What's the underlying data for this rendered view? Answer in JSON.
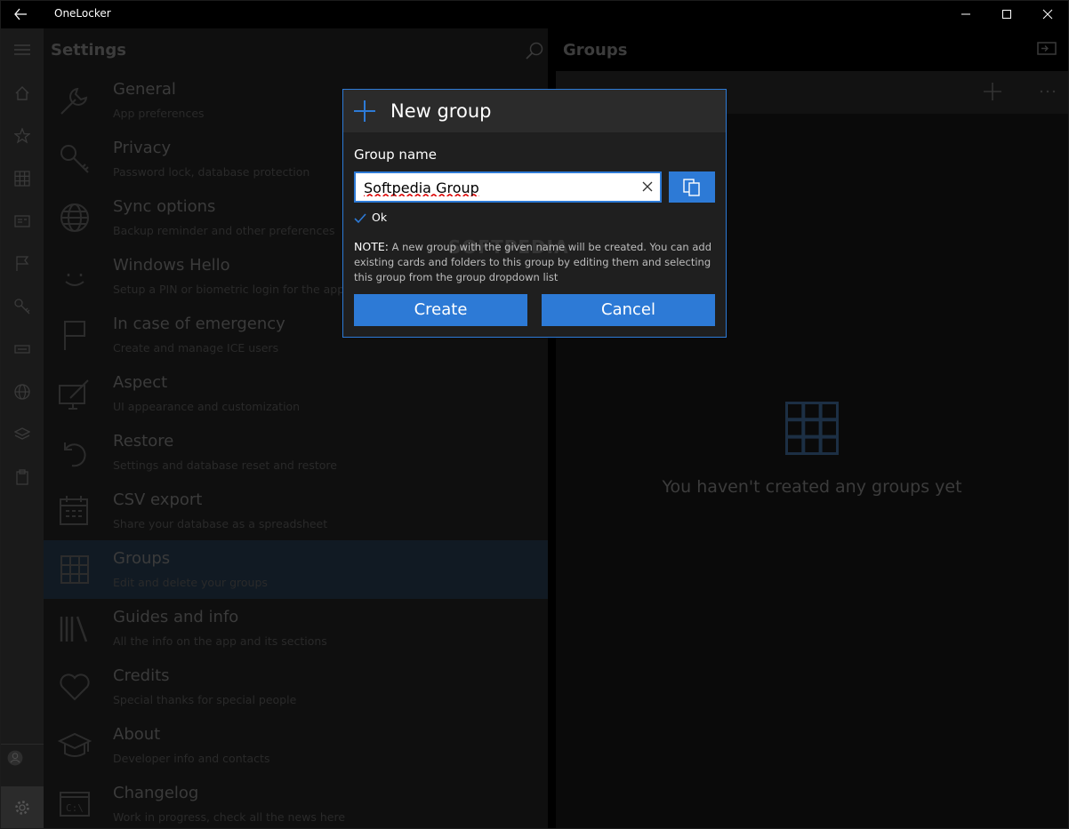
{
  "titlebar": {
    "app_title": "OneLocker"
  },
  "settings": {
    "heading": "Settings",
    "items": [
      {
        "title": "General",
        "subtitle": "App preferences",
        "icon": "wrench-icon"
      },
      {
        "title": "Privacy",
        "subtitle": "Password lock, database protection",
        "icon": "key-icon"
      },
      {
        "title": "Sync options",
        "subtitle": "Backup reminder and other preferences",
        "icon": "globe-icon"
      },
      {
        "title": "Windows Hello",
        "subtitle": "Setup a PIN or biometric login for the app",
        "icon": "smile-icon"
      },
      {
        "title": "In case of emergency",
        "subtitle": "Create and manage ICE users",
        "icon": "flag-icon"
      },
      {
        "title": "Aspect",
        "subtitle": "UI appearance and customization",
        "icon": "paint-icon"
      },
      {
        "title": "Restore",
        "subtitle": "Settings and database reset and restore",
        "icon": "undo-icon"
      },
      {
        "title": "CSV export",
        "subtitle": "Share your database as a spreadsheet",
        "icon": "calendar-icon"
      },
      {
        "title": "Groups",
        "subtitle": "Edit and delete your groups",
        "icon": "grid-icon",
        "selected": true
      },
      {
        "title": "Guides and info",
        "subtitle": "All the info on the app and its sections",
        "icon": "books-icon"
      },
      {
        "title": "Credits",
        "subtitle": "Special thanks for special people",
        "icon": "heart-icon"
      },
      {
        "title": "About",
        "subtitle": "Developer info and contacts",
        "icon": "graduation-cap-icon"
      },
      {
        "title": "Changelog",
        "subtitle": "Work in progress, check all the news here",
        "icon": "terminal-icon"
      }
    ]
  },
  "groups": {
    "heading": "Groups",
    "empty_text": "You haven't created any groups yet"
  },
  "dialog": {
    "title": "New group",
    "field_label": "Group name",
    "field_value": "Softpedia Group",
    "validation": "Ok",
    "note_label": "NOTE:",
    "note_text": " A new group with the given name will be created. You can add existing cards and folders to this group by editing them and selecting this group from the group dropdown list",
    "create_label": "Create",
    "cancel_label": "Cancel"
  },
  "watermark": "SOFTPEDIA",
  "colors": {
    "accent": "#2d7ad6",
    "background": "#000000"
  }
}
